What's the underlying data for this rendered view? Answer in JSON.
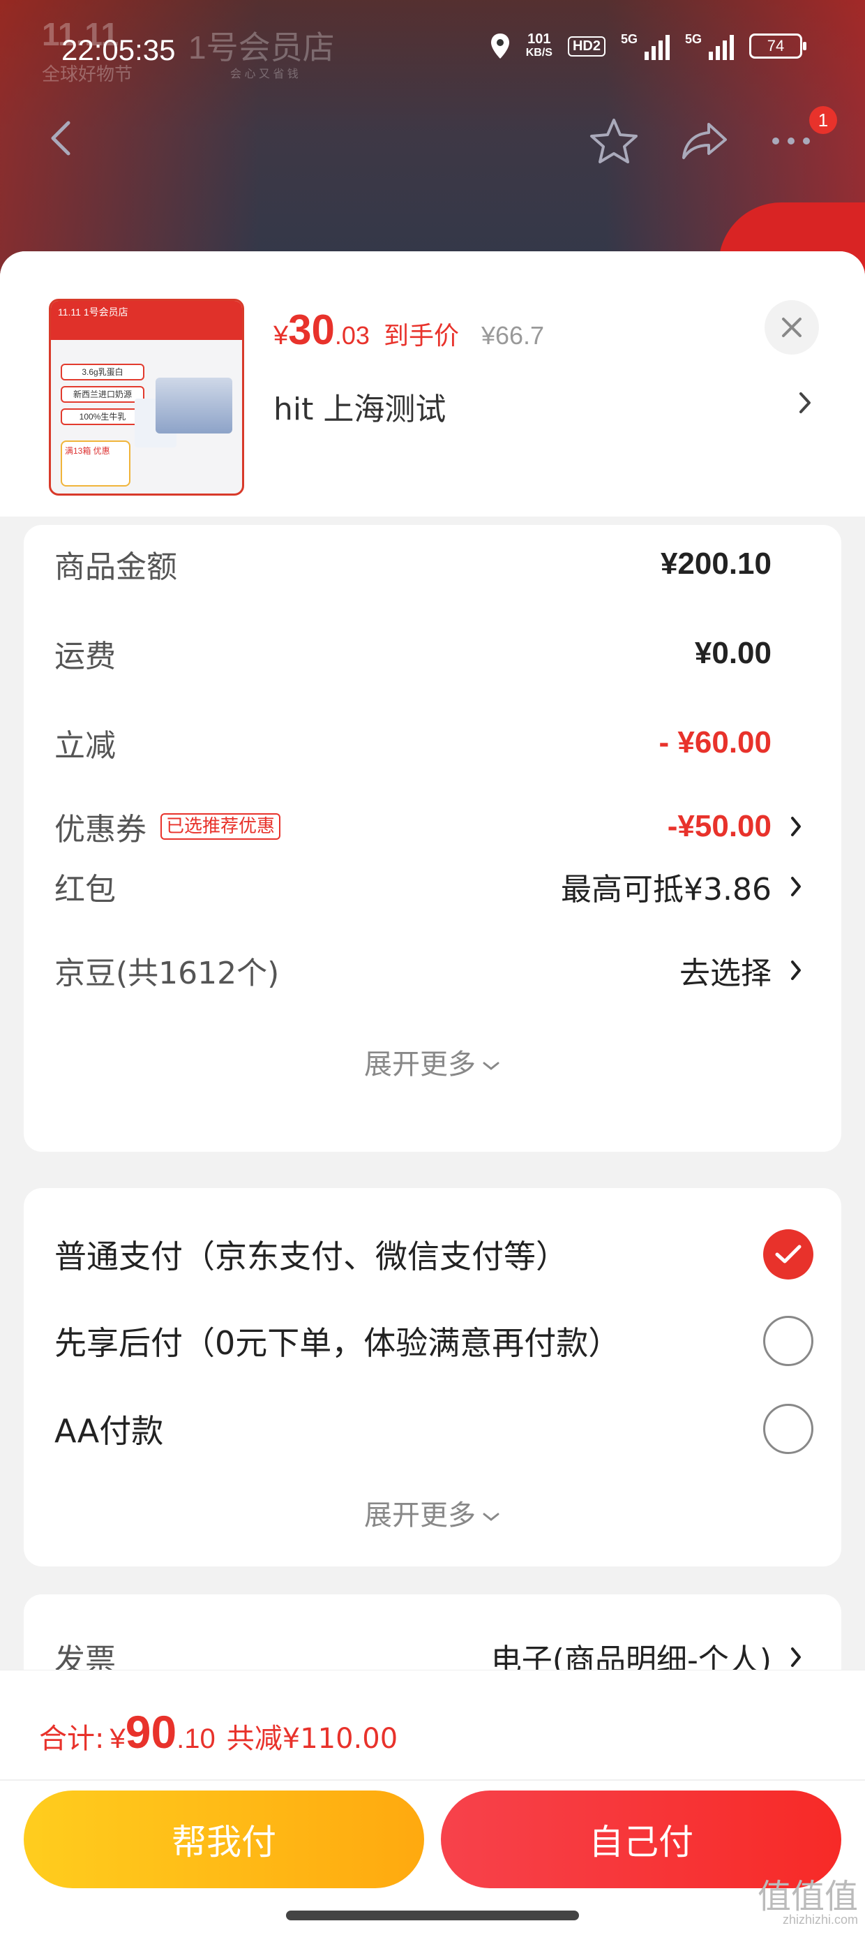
{
  "background": {
    "brand_line1": "11.11",
    "brand_line2": "全球好物节",
    "brand_store": "1号会员店",
    "brand_store_sub": "会 心 又 省 钱"
  },
  "status_bar": {
    "time": "22:05:35",
    "net_speed": "101",
    "net_unit": "KB/S",
    "hd": "HD2",
    "sim1": "5G",
    "sim2": "5G",
    "battery": "74"
  },
  "nav": {
    "more_badge": "1"
  },
  "product": {
    "thumb_header": "11.11 1号会员店",
    "thumb_tag1": "3.6g乳蛋白",
    "thumb_tag2": "新西兰进口奶源",
    "thumb_tag3": "100%生牛乳",
    "thumb_coupon": "满13箱 优惠",
    "price_yen": "¥",
    "price_int": "30",
    "price_dec": ".03",
    "price_label": "到手价",
    "price_original": "¥66.7",
    "title": "hit  上海测试"
  },
  "amounts": {
    "rows": [
      {
        "label": "商品金额",
        "value": "¥200.10"
      },
      {
        "label": "运费",
        "value": "¥0.00"
      },
      {
        "label": "立减",
        "value": "- ¥60.00"
      },
      {
        "label": "优惠券",
        "badge": "已选推荐优惠",
        "value": "-¥50.00"
      },
      {
        "label": "红包",
        "value": "最高可抵¥3.86"
      },
      {
        "label": "京豆(共1612个)",
        "value": "去选择"
      }
    ],
    "expand": "展开更多"
  },
  "payment": {
    "options": [
      {
        "label": "普通支付（京东支付、微信支付等）",
        "selected": true
      },
      {
        "label": "先享后付（0元下单，体验满意再付款）",
        "selected": false
      },
      {
        "label": "AA付款",
        "selected": false
      }
    ],
    "expand": "展开更多"
  },
  "invoice": {
    "label": "发票",
    "value": "电子(商品明细-个人)"
  },
  "footer": {
    "total_label": "合计:",
    "total_yen": "¥",
    "total_int": "90",
    "total_dec": ".10",
    "total_saved": "共减¥110.00",
    "help_pay": "帮我付",
    "self_pay": "自己付"
  },
  "watermark": {
    "text": "值值值",
    "sub": "zhizhizhi.com"
  },
  "colors": {
    "accent_red": "#e8322b",
    "help_btn": "#ffb414",
    "self_btn": "#f7342f"
  }
}
